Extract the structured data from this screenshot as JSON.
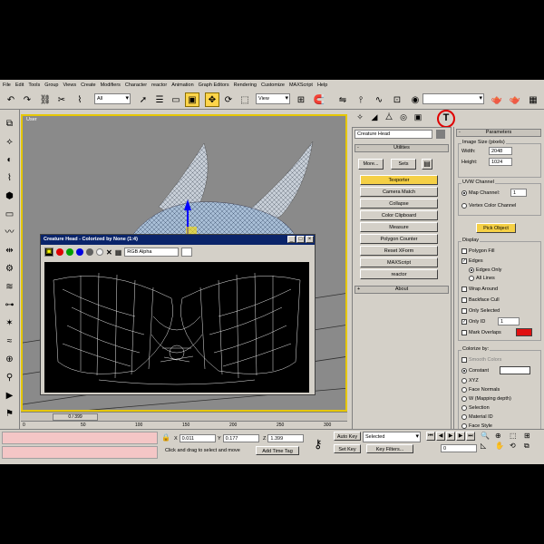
{
  "menu": [
    "File",
    "Edit",
    "Tools",
    "Group",
    "Views",
    "Create",
    "Modifiers",
    "Character",
    "reactor",
    "Animation",
    "Graph Editors",
    "Rendering",
    "Customize",
    "MAXScript",
    "Help"
  ],
  "toolbar": {
    "selection_filter": "All",
    "ref_coord": "View",
    "named_sel": ""
  },
  "viewport": {
    "label": "User"
  },
  "subwindow": {
    "title": "Creature Head - Colorized by None (1:4)",
    "channel": "RGB Alpha",
    "minimize": "_",
    "maximize": "□",
    "close": "×"
  },
  "cmdpanel": {
    "object_name": "Creature Head",
    "utilities_title": "Utilities",
    "more_label": "More...",
    "sets_label": "Sets",
    "buttons": [
      "Texporter",
      "Camera Match",
      "Collapse",
      "Color Clipboard",
      "Measure",
      "Polygon Counter",
      "Reset XForm",
      "MAXScript",
      "reactor"
    ],
    "active_button": "Texporter",
    "about_label": "About"
  },
  "params": {
    "title": "Parameters",
    "image_size_title": "Image Size (pixels)",
    "width_label": "Width:",
    "width_value": "2048",
    "height_label": "Height:",
    "height_value": "1024",
    "uvw_title": "UVW Channel",
    "map_channel_label": "Map Channel:",
    "map_channel_value": "1",
    "vertex_color_label": "Vertex Color Channel",
    "pick_object_label": "Pick Object",
    "display_title": "Display",
    "polygon_fill": "Polygon Fill",
    "edges": "Edges",
    "edges_only": "Edges Only",
    "all_lines": "All Lines",
    "wrap_around": "Wrap Around",
    "backface_cull": "Backface Cull",
    "only_selected": "Only Selected",
    "only_id": "Only ID",
    "only_id_value": "1",
    "mark_overlaps": "Mark Overlaps",
    "colorize_title": "Colorize by:",
    "smooth_colors": "Smooth Colors",
    "constant": "Constant",
    "xyz": "XYZ",
    "face_normals": "Face Normals",
    "w_mapping": "W (Mapping depth)",
    "selection": "Selection",
    "material_id": "Material ID",
    "face_style": "Face Style",
    "overlap_color": "#e01010"
  },
  "timeline": {
    "slider": "0 / 399",
    "ticks": [
      "0",
      "50",
      "100",
      "150",
      "200",
      "250",
      "300"
    ]
  },
  "status": {
    "x_label": "X",
    "x_value": "0.011",
    "y_label": "Y",
    "y_value": "0.177",
    "z_label": "Z",
    "z_value": "1.399",
    "prompt": "Click and drag to select and move",
    "add_time_tag": "Add Time Tag",
    "autokey": "Auto Key",
    "setkey": "Set Key",
    "key_mode": "Selected",
    "key_filters": "Key Filters...",
    "frame": "0"
  }
}
